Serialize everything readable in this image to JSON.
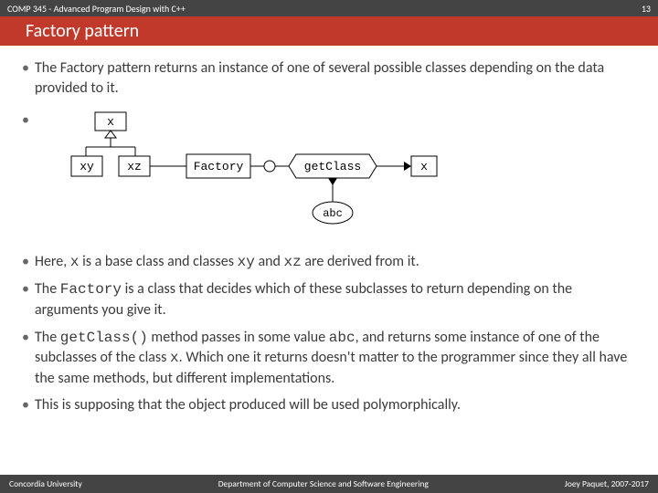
{
  "header": {
    "course": "COMP 345 - Advanced Program Design with C++",
    "page_num": "13"
  },
  "title": "Factory pattern",
  "bullet1": {
    "t1": "The Factory pattern returns an instance of one of several possible classes depending on the data provided to it."
  },
  "diagram": {
    "x": "x",
    "xy": "xy",
    "xz": "xz",
    "factory": "Factory",
    "getClass": "getClass",
    "abc": "abc"
  },
  "bullet2": {
    "a": "Here, ",
    "x": "x",
    "b": " is a base class and classes ",
    "xy": "xy",
    "c": " and ",
    "xz": "xz",
    "d": " are derived from it."
  },
  "bullet3": {
    "a": "The ",
    "factory": "Factory",
    "b": " is a class that decides which of these subclasses to return depending on the arguments you give it."
  },
  "bullet4": {
    "a": "The ",
    "gc": "getClass()",
    "b": " method passes in some value ",
    "abc": "abc",
    "c": ", and returns some instance of one of the subclasses of the class ",
    "x": "x",
    "d": ". Which one it returns doesn't matter to the programmer since they all have the same methods, but different implementations."
  },
  "bullet5": {
    "a": "This is supposing that the object produced will be used polymorphically."
  },
  "footer": {
    "left": "Concordia University",
    "center": "Department of Computer Science and Software Engineering",
    "right": "Joey Paquet, 2007-2017"
  }
}
